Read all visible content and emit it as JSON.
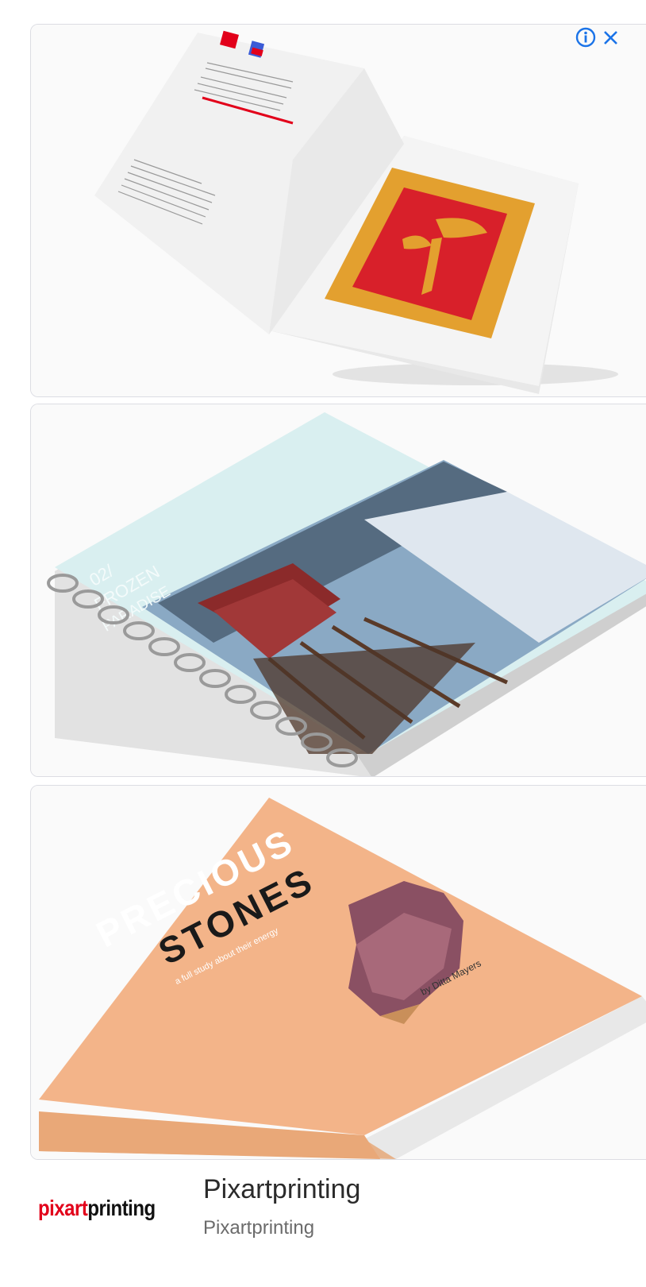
{
  "ad": {
    "advertiser_name": "Pixartprinting",
    "advertiser_subtitle": "Pixartprinting",
    "logo": {
      "part1": "pixart",
      "part2": "printing"
    },
    "colors": {
      "logo_red": "#e2001a",
      "info_blue": "#1a73e8"
    },
    "icons": {
      "info": "info-icon",
      "close": "close-icon"
    }
  },
  "products": [
    {
      "name": "open-booklet"
    },
    {
      "name": "spiral-notebook",
      "cover_text": {
        "line1": "02/",
        "line2": "FROZEN",
        "line3": "PARADISE"
      }
    },
    {
      "name": "hardcover-book",
      "cover_text": {
        "title1": "PRECIOUS",
        "title2": "STONES",
        "subtitle": "a full study about their energy",
        "author": "by Ditta Mayers"
      }
    }
  ]
}
